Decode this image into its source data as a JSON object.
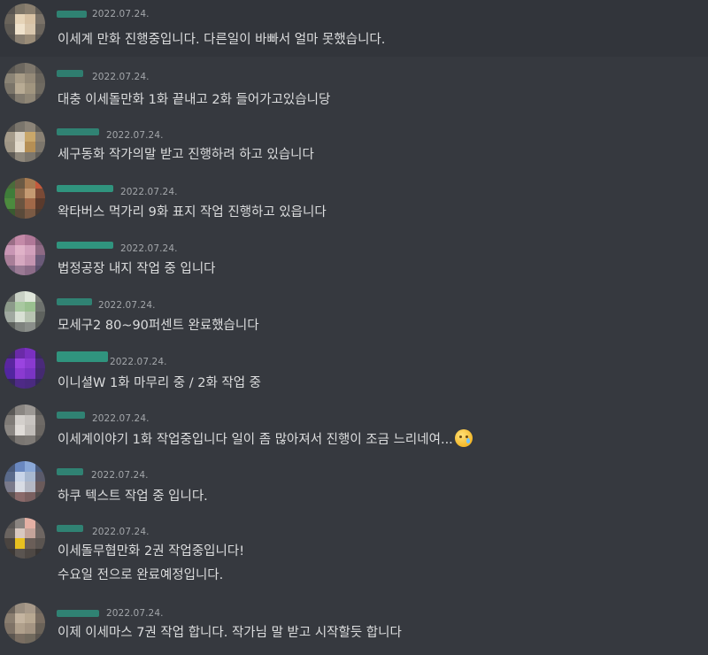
{
  "channel": {
    "messages": [
      {
        "timestamp": "2022.07.24.",
        "lines": [
          "이세계 만화 진행중입니다. 다른일이 바빠서 얼마 못했습니다."
        ]
      },
      {
        "timestamp": "2022.07.24.",
        "lines": [
          "대충 이세돌만화 1화 끝내고 2화 들어가고있습니당"
        ]
      },
      {
        "timestamp": "2022.07.24.",
        "lines": [
          "세구동화 작가의말 받고 진행하려 하고 있습니다"
        ]
      },
      {
        "timestamp": "2022.07.24.",
        "lines": [
          "왁타버스 먹가리 9화 표지 작업 진행하고 있읍니다"
        ]
      },
      {
        "timestamp": "2022.07.24.",
        "lines": [
          "법정공장 내지 작업 중 입니다"
        ]
      },
      {
        "timestamp": "2022.07.24.",
        "lines": [
          "모세구2 80~90퍼센트 완료했습니다"
        ]
      },
      {
        "timestamp": "2022.07.24.",
        "lines": [
          "이니셜W 1화 마무리 중 / 2화 작업 중"
        ]
      },
      {
        "timestamp": "2022.07.24.",
        "lines": [
          "이세계이야기 1화 작업중입니다 일이 좀 많아져서 진행이 조금 느리네여..."
        ],
        "emoji": "crying-face-emoji"
      },
      {
        "timestamp": "2022.07.24.",
        "lines": [
          "하쿠 텍스트 작업 중 입니다."
        ]
      },
      {
        "timestamp": "2022.07.24.",
        "lines": [
          "이세돌무협만화 2권 작업중입니다!",
          "수요일 전으로 완료예정입니다."
        ]
      },
      {
        "timestamp": "2022.07.24.",
        "lines": [
          "이제 이세마스 7권 작업 합니다. 작가님 말 받고 시작할듯 합니다"
        ]
      }
    ]
  },
  "colors": {
    "background": "#36393f",
    "text": "#dcddde",
    "timestamp": "#a3a6aa",
    "username_blur": "#2fa58a"
  }
}
